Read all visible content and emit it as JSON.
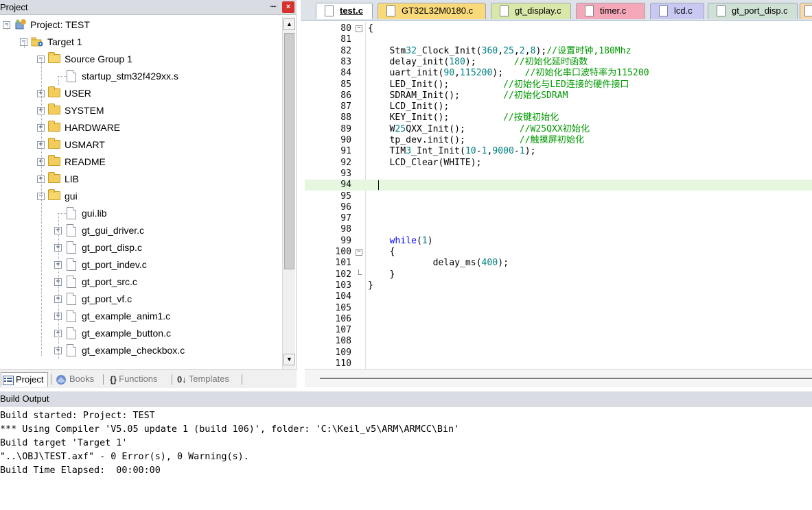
{
  "project_panel": {
    "title": "Project",
    "pin_glyph": "ᅲ",
    "close_glyph": "×",
    "tree": [
      {
        "label": "Project: TEST",
        "icon": "project-icon",
        "expander": "−"
      },
      {
        "label": "Target 1",
        "icon": "target-icon",
        "expander": "−"
      },
      {
        "label": "Source Group 1",
        "icon": "folder-open-icon",
        "expander": "−"
      },
      {
        "label": "startup_stm32f429xx.s",
        "icon": "file-icon",
        "expander": ""
      },
      {
        "label": "USER",
        "icon": "folder-icon",
        "expander": "+"
      },
      {
        "label": "SYSTEM",
        "icon": "folder-icon",
        "expander": "+"
      },
      {
        "label": "HARDWARE",
        "icon": "folder-icon",
        "expander": "+"
      },
      {
        "label": "USMART",
        "icon": "folder-icon",
        "expander": "+"
      },
      {
        "label": "README",
        "icon": "folder-icon",
        "expander": "+"
      },
      {
        "label": "LIB",
        "icon": "folder-icon",
        "expander": "+"
      },
      {
        "label": "gui",
        "icon": "folder-open-icon",
        "expander": "−"
      },
      {
        "label": "gui.lib",
        "icon": "file-icon",
        "expander": ""
      },
      {
        "label": "gt_gui_driver.c",
        "icon": "file-icon",
        "expander": "+"
      },
      {
        "label": "gt_port_disp.c",
        "icon": "file-icon",
        "expander": "+"
      },
      {
        "label": "gt_port_indev.c",
        "icon": "file-icon",
        "expander": "+"
      },
      {
        "label": "gt_port_src.c",
        "icon": "file-icon",
        "expander": "+"
      },
      {
        "label": "gt_port_vf.c",
        "icon": "file-icon",
        "expander": "+"
      },
      {
        "label": "gt_example_anim1.c",
        "icon": "file-icon",
        "expander": "+"
      },
      {
        "label": "gt_example_button.c",
        "icon": "file-icon",
        "expander": "+"
      },
      {
        "label": "gt_example_checkbox.c",
        "icon": "file-icon",
        "expander": "+"
      }
    ],
    "tabs": [
      {
        "label": "Project",
        "icon": "project-tab-icon",
        "active": true
      },
      {
        "label": "Books",
        "icon": "books-icon",
        "active": false
      },
      {
        "label": "Functions",
        "icon": "functions-icon",
        "active": false
      },
      {
        "label": "Templates",
        "icon": "templates-icon",
        "active": false
      }
    ],
    "functions_glyph": "{}",
    "templates_glyph": "0↓"
  },
  "editor": {
    "tabs": [
      {
        "label": "test.c",
        "color": "#ffffff",
        "active": true
      },
      {
        "label": "GT32L32M0180.c",
        "color": "#f9d97a"
      },
      {
        "label": "gt_display.c",
        "color": "#d9e8a8"
      },
      {
        "label": "timer.c",
        "color": "#f4a8b8"
      },
      {
        "label": "lcd.c",
        "color": "#c8c9f2"
      },
      {
        "label": "gt_port_disp.c",
        "color": "#cfe0d5"
      },
      {
        "label": "",
        "color": "#fbd8a8"
      }
    ],
    "current_line": 94,
    "lines": [
      {
        "n": "80",
        "fold": "−",
        "code": "{"
      },
      {
        "n": "81",
        "code": ""
      },
      {
        "n": "82",
        "code": "    Stm32_Clock_Init(360,25,2,8);//设置时钟,180Mhz"
      },
      {
        "n": "83",
        "code": "    delay_init(180);       //初始化延时函数"
      },
      {
        "n": "84",
        "code": "    uart_init(90,115200);    //初始化串口波特率为115200"
      },
      {
        "n": "85",
        "code": "    LED_Init();          //初始化与LED连接的硬件接口"
      },
      {
        "n": "86",
        "code": "    SDRAM_Init();        //初始化SDRAM"
      },
      {
        "n": "87",
        "code": "    LCD_Init();"
      },
      {
        "n": "88",
        "code": "    KEY_Init();          //按键初始化"
      },
      {
        "n": "89",
        "code": "    W25QXX_Init();          //W25QXX初始化"
      },
      {
        "n": "90",
        "code": "    tp_dev.init();          //触摸屏初始化"
      },
      {
        "n": "91",
        "code": "    TIM3_Int_Init(10-1,9000-1);"
      },
      {
        "n": "92",
        "code": "    LCD_Clear(WHITE);"
      },
      {
        "n": "93",
        "code": ""
      },
      {
        "n": "94",
        "code": ""
      },
      {
        "n": "95",
        "code": ""
      },
      {
        "n": "96",
        "code": ""
      },
      {
        "n": "97",
        "code": ""
      },
      {
        "n": "98",
        "code": ""
      },
      {
        "n": "99",
        "code": "    while(1)"
      },
      {
        "n": "100",
        "fold": "−",
        "code": "    {"
      },
      {
        "n": "101",
        "code": "            delay_ms(400);"
      },
      {
        "n": "102",
        "foldend": true,
        "code": "    }"
      },
      {
        "n": "103",
        "code": "}"
      },
      {
        "n": "104",
        "code": ""
      },
      {
        "n": "105",
        "code": ""
      },
      {
        "n": "106",
        "code": ""
      },
      {
        "n": "107",
        "code": ""
      },
      {
        "n": "108",
        "code": ""
      },
      {
        "n": "109",
        "code": ""
      },
      {
        "n": "110",
        "code": ""
      }
    ]
  },
  "build_output": {
    "title": "Build Output",
    "lines": [
      "Build started: Project: TEST",
      "*** Using Compiler 'V5.05 update 1 (build 106)', folder: 'C:\\Keil_v5\\ARM\\ARMCC\\Bin'",
      "Build target 'Target 1'",
      "\"..\\OBJ\\TEST.axf\" - 0 Error(s), 0 Warning(s).",
      "Build Time Elapsed:  00:00:00"
    ]
  },
  "colors": {
    "keyword": "#0000ff",
    "number": "#008080",
    "comment": "#009900",
    "current_line_bg": "#e6f7e0"
  }
}
